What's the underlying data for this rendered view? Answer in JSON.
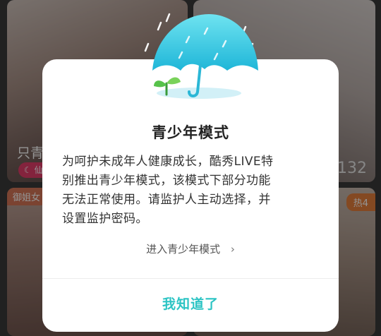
{
  "feed": {
    "card_top_left": {
      "title": "只青",
      "badge": "仙7"
    },
    "card_top_right": {
      "viewer_count": "132"
    },
    "card_bottom_left": {
      "tag": "御姐女"
    },
    "card_bottom_right": {
      "tag": "热4"
    }
  },
  "modal": {
    "title": "青少年模式",
    "body_lines": [
      "为呵护未成年人健康成长，酷秀LIVE特",
      "别推出青少年模式，该模式下部分功能",
      "无法正常使用。请监护人主动选择，并",
      "设置监护密码。"
    ],
    "enter_link": "进入青少年模式",
    "enter_chevron": "›",
    "confirm_button": "我知道了",
    "accent_color": "#2cc4c4",
    "illustration_icon": "umbrella-sprout-icon"
  }
}
